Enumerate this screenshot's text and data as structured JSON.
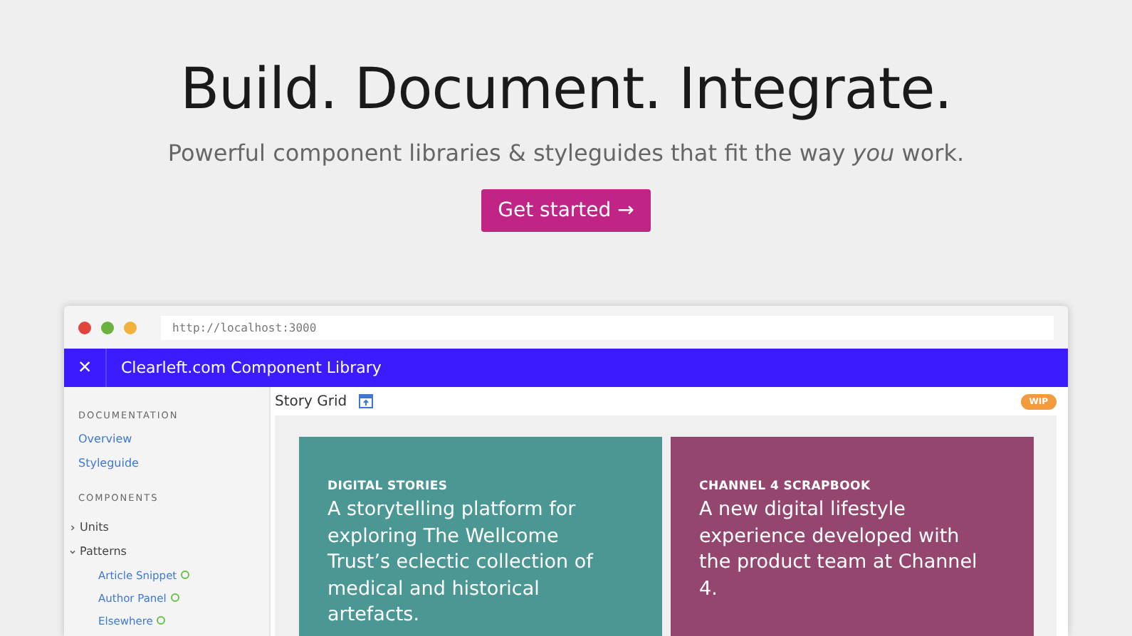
{
  "hero": {
    "title": "Build. Document. Integrate.",
    "subtitle": "Powerful component libraries & styleguides that fit the way *you* work.",
    "button": "Get started →"
  },
  "browser": {
    "url": "http://localhost:3000",
    "app_title": "Clearleft.com Component Library",
    "close": "×"
  },
  "sidebar": {
    "sections": [
      {
        "heading": "DOCUMENTATION",
        "items": [
          {
            "label": "Overview",
            "selected": false
          },
          {
            "label": "Styleguide",
            "selected": false
          }
        ]
      },
      {
        "heading": "COMPONENTS",
        "tree": [
          {
            "label": "Units",
            "expanded": false
          },
          {
            "label": "Patterns",
            "expanded": true,
            "children": [
              {
                "label": "Article Snippet"
              },
              {
                "label": "Author Panel"
              },
              {
                "label": "Elsewhere"
              }
            ]
          }
        ]
      }
    ]
  },
  "main": {
    "title": "Story Grid",
    "badge": "WIP",
    "cards": [
      {
        "kicker": "DIGITAL STORIES",
        "text": "A storytelling platform for exploring The Wellcome Trust’s eclectic collection of medical and historical artefacts.",
        "color": "#4a9793"
      },
      {
        "kicker": "CHANNEL 4 SCRAPBOOK",
        "text": "A new digital lifestyle experience developed with the product team at Channel 4.",
        "color": "#94466f"
      }
    ]
  }
}
